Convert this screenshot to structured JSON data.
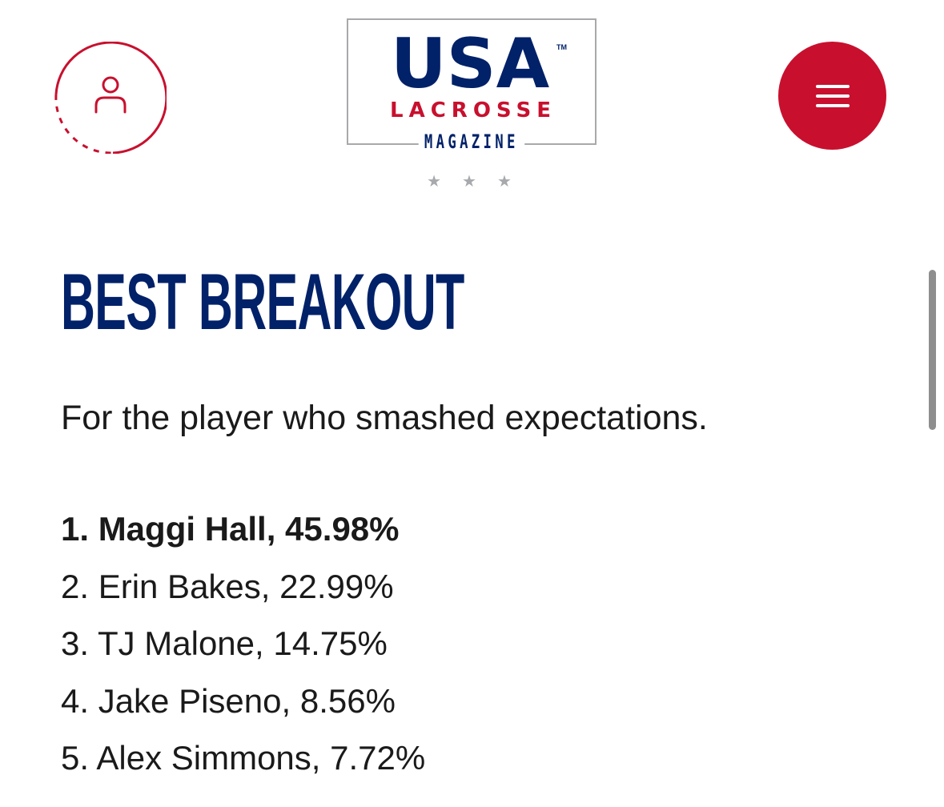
{
  "header": {
    "account_icon": "user-account-icon",
    "menu_icon": "hamburger-menu-icon",
    "logo": {
      "usa": "USA",
      "tm": "TM",
      "lacrosse": "LACROSSE",
      "magazine": "MAGAZINE",
      "stars": "★★★"
    }
  },
  "main": {
    "title": "BEST BREAKOUT",
    "subtitle": "For the player who smashed expectations.",
    "results": [
      "1. Maggi Hall, 45.98%",
      "2. Erin Bakes, 22.99%",
      "3. TJ Malone, 14.75%",
      "4. Jake Piseno, 8.56%",
      "5. Alex Simmons, 7.72%"
    ]
  },
  "colors": {
    "navy": "#012169",
    "red": "#c8102e",
    "gray": "#a7a9ac"
  }
}
